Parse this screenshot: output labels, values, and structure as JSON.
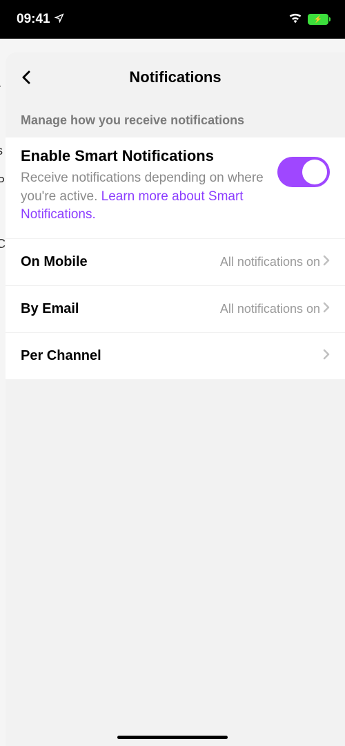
{
  "status": {
    "time": "09:41"
  },
  "modal": {
    "title": "Notifications",
    "sectionHeader": "Manage how you receive notifications",
    "smart": {
      "title": "Enable Smart Notifications",
      "desc": "Receive notifications depending on where you're active. ",
      "learnMore": "Learn more about Smart Notifications."
    },
    "rows": {
      "mobile": {
        "label": "On Mobile",
        "value": "All notifications on"
      },
      "email": {
        "label": "By Email",
        "value": "All notifications on"
      },
      "channel": {
        "label": "Per Channel",
        "value": ""
      }
    }
  }
}
